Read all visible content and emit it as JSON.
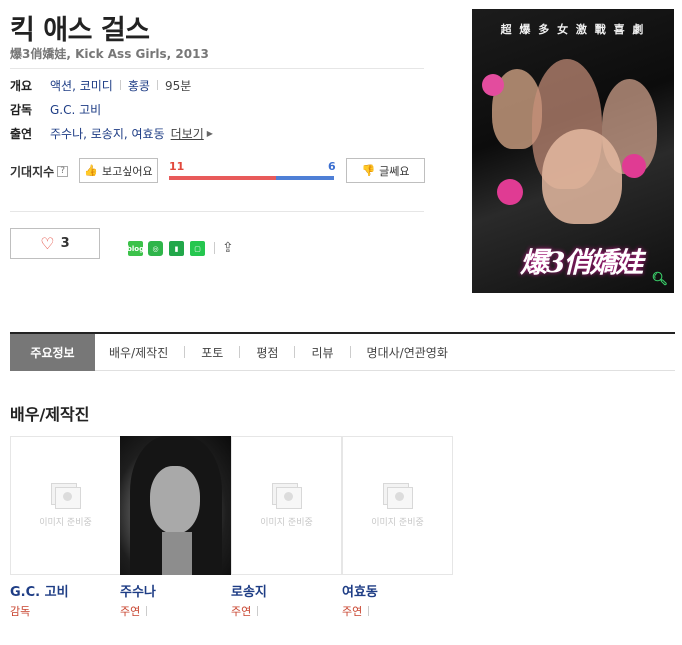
{
  "header": {
    "title": "킥 애스 걸스",
    "subtitle": "爆3俏嬌娃, Kick Ass Girls, 2013"
  },
  "info": {
    "overview_label": "개요",
    "genre": "액션, 코미디",
    "country": "홍콩",
    "runtime": "95분",
    "director_label": "감독",
    "director": "G.C. 고비",
    "cast_label": "출연",
    "cast": "주수나, 로송지, 여효동",
    "more_label": "더보기"
  },
  "expect": {
    "label": "기대지수",
    "help": "?",
    "want_label": "보고싶어요",
    "meh_label": "글쎄요",
    "want_count": "11",
    "meh_count": "6",
    "want_fraction": 0.647
  },
  "social": {
    "like_count": "3",
    "blog_label": "blog"
  },
  "poster": {
    "top_text": "超 爆 多 女 激 戰 喜 劇",
    "logo_text": "爆3俏嬌娃"
  },
  "tabs": [
    {
      "label": "주요정보"
    },
    {
      "label": "배우/제작진"
    },
    {
      "label": "포토"
    },
    {
      "label": "평점"
    },
    {
      "label": "리뷰"
    },
    {
      "label": "명대사/연관영화"
    }
  ],
  "section": {
    "title": "배우/제작진"
  },
  "cast_cards": [
    {
      "name": "G.C. 고비",
      "role": "감독",
      "placeholder": "이미지 준비중"
    },
    {
      "name": "주수나",
      "role": "주연"
    },
    {
      "name": "로송지",
      "role": "주연",
      "placeholder": "이미지 준비중"
    },
    {
      "name": "여효동",
      "role": "주연",
      "placeholder": "이미지 준비중"
    }
  ],
  "colors": {
    "accent_blue": "#1e3d85",
    "like_red": "#e85a5a",
    "meh_blue": "#4e7fd6",
    "role_red": "#c8432e"
  }
}
